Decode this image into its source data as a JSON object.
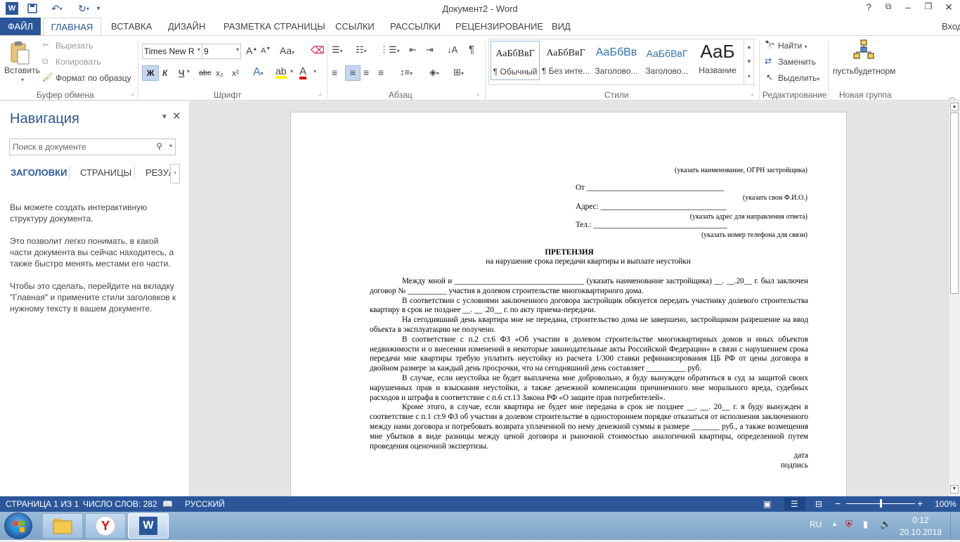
{
  "window": {
    "title": "Документ2 - Word",
    "help": "?",
    "sign_in": "Вход"
  },
  "tabs": {
    "file": "ФАЙЛ",
    "home": "ГЛАВНАЯ",
    "insert": "ВСТАВКА",
    "design": "ДИЗАЙН",
    "layout": "РАЗМЕТКА СТРАНИЦЫ",
    "references": "ССЫЛКИ",
    "mailings": "РАССЫЛКИ",
    "review": "РЕЦЕНЗИРОВАНИЕ",
    "view": "ВИД"
  },
  "ribbon": {
    "clipboard": {
      "paste": "Вставить",
      "cut": "Вырезать",
      "copy": "Копировать",
      "format_painter": "Формат по образцу",
      "label": "Буфер обмена"
    },
    "font": {
      "name": "Times New R",
      "size": "9",
      "grow": "A",
      "shrink": "A",
      "case": "Aa",
      "bold": "Ж",
      "italic": "К",
      "underline": "Ч",
      "strike": "abc",
      "subscript": "x₂",
      "superscript": "x²",
      "label": "Шрифт"
    },
    "paragraph": {
      "label": "Абзац"
    },
    "styles": {
      "items": [
        {
          "preview": "АаБбВвГ",
          "name": "¶ Обычный"
        },
        {
          "preview": "АаБбВвГ",
          "name": "¶ Без инте..."
        },
        {
          "preview": "АаБбВв",
          "name": "Заголово..."
        },
        {
          "preview": "АаБбВвГ",
          "name": "Заголово..."
        },
        {
          "preview": "АаБ",
          "name": "Название"
        }
      ],
      "label": "Стили"
    },
    "editing": {
      "find": "Найти",
      "replace": "Заменить",
      "select": "Выделить",
      "label": "Редактирование"
    },
    "custom": {
      "button": "пустьбудетнорм",
      "label": "Новая группа"
    }
  },
  "nav": {
    "title": "Навигация",
    "search_placeholder": "Поиск в документе",
    "tab_headings": "ЗАГОЛОВКИ",
    "tab_pages": "СТРАНИЦЫ",
    "tab_results": "РЕЗУЛ",
    "help1": "Вы можете создать интерактивную структуру документа.",
    "help2": "Это позволит легко понимать, в какой части документа вы сейчас находитесь, а также быстро менять местами его части.",
    "help3": "Чтобы это сделать, перейдите на вкладку \"Главная\" и примените стили заголовков к нужному тексту в вашем документе."
  },
  "document": {
    "header_note": "(указать наименование, ОГРН застройщика)",
    "from": "От ___________________________________",
    "from_note": "(указать свои Ф.И.О.)",
    "address": "Адрес: ________________________________",
    "address_note": "(указать адрес для направления ответа)",
    "phone": "Тел.: __________________________________",
    "phone_note": "(указать номер телефона для связи)",
    "title": "ПРЕТЕНЗИЯ",
    "subtitle": "на нарушение срока передачи квартиры и выплате неустойки",
    "paragraphs": [
      "Между мной и _________________________________ (указать наименование застройщика) __. __.20__ г. был заключен договор № __________ участия в долевом строительстве многоквартирного дома.",
      "В соответствии с условиями заключенного договора застройщик обязуется передать участнику долевого строительства квартиру в срок не позднее __. __ .20__ г. по акту приема-передачи.",
      "На сегодняшний день квартира мне не передана, строительство дома не завершено, застройщиком разрешение на ввод объекта в эксплуатацию не получено.",
      "В соответствие с п.2 ст.6 ФЗ «Об участии в долевом строительстве многоквартирных домов и иных объектов недвижимости и о внесении изменений в некоторые законодательные акты Российской Федерации» в связи с нарушением срока передачи мне квартиры требую уплатить неустойку из расчета 1/300 ставки рефинансирования ЦБ РФ от цены договора в двойном размере за каждый день просрочки, что на сегодняшний день составляет __________ руб.",
      "В случае, если неустойка не будет выплачена мне добровольно, я буду вынужден обратиться в суд за защитой своих нарушенных прав и взыскания неустойки, а также денежной компенсации причиненного мне морального вреда, судебных расходов и штрафа в соответствие с п.6 ст.13 Закона РФ «О защите прав потребителей».",
      "Кроме этого, в случае, если квартира не будет мне передана в срок не позднее __. __. 20__ г. я буду вынужден в соответствие с п.1 ст.9 ФЗ об участии в долевом строительстве в одностороннем порядке отказаться от исполнения заключенного между нами договора и потребовать возврата уплаченной по нему денежной суммы в размере _______ руб., а также возмещения мне убытков в виде разницы между ценой договора и рыночной стоимостью аналогичной квартиры, определенной путем проведения оценочной экспертизы."
    ],
    "date": "дата",
    "signature": "подпись"
  },
  "status": {
    "page": "СТРАНИЦА 1 ИЗ 1",
    "words": "ЧИСЛО СЛОВ: 282",
    "language": "РУССКИЙ",
    "zoom": "100%",
    "zoom_level": 100
  },
  "taskbar": {
    "lang": "RU",
    "time": "0:12",
    "date": "20.10.2018"
  }
}
